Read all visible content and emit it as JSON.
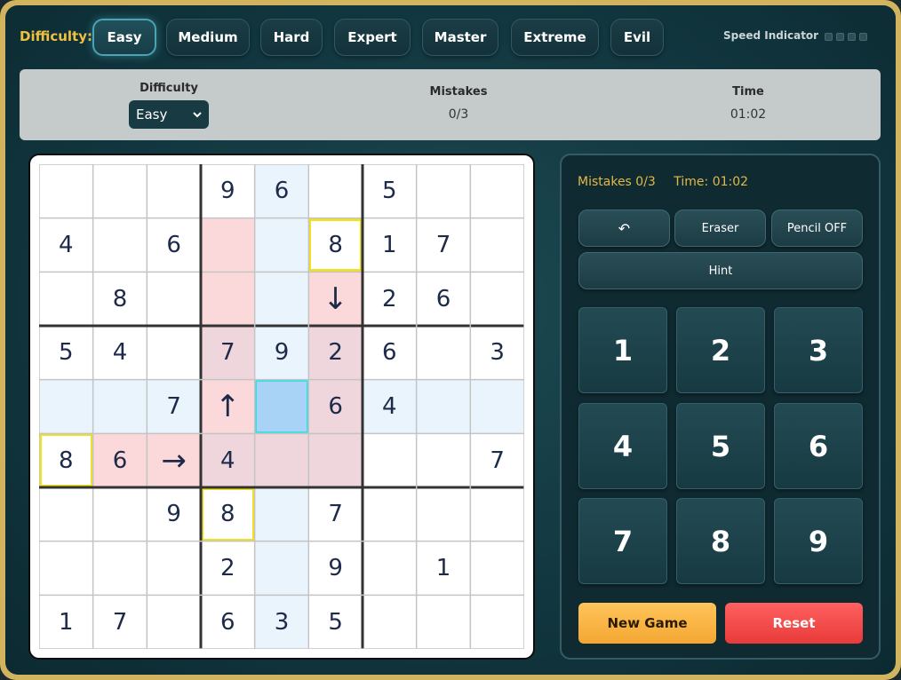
{
  "topbar": {
    "difficulty_label": "Difficulty:",
    "levels": [
      "Easy",
      "Medium",
      "Hard",
      "Expert",
      "Master",
      "Extreme",
      "Evil"
    ],
    "active_level": "Easy",
    "speed_label": "Speed Indicator"
  },
  "infobar": {
    "difficulty_head": "Difficulty",
    "difficulty_value": "Easy",
    "mistakes_head": "Mistakes",
    "mistakes_value": "0/3",
    "time_head": "Time",
    "time_value": "01:02"
  },
  "board": {
    "rows": [
      [
        "",
        "",
        "",
        "9",
        "6",
        "",
        "5",
        "",
        ""
      ],
      [
        "4",
        "",
        "6",
        "",
        "",
        "8",
        "1",
        "7",
        ""
      ],
      [
        "",
        "8",
        "",
        "",
        "",
        "↓",
        "2",
        "6",
        ""
      ],
      [
        "5",
        "4",
        "",
        "7",
        "9",
        "2",
        "6",
        "",
        "3"
      ],
      [
        "",
        "",
        "7",
        "↑",
        "",
        "6",
        "4",
        "",
        ""
      ],
      [
        "8",
        "6",
        "→",
        "4",
        "",
        "",
        "",
        "",
        "7"
      ],
      [
        "",
        "",
        "9",
        "8",
        "",
        "7",
        "",
        "",
        ""
      ],
      [
        "",
        "",
        "",
        "2",
        "",
        "9",
        "",
        "1",
        ""
      ],
      [
        "1",
        "7",
        "",
        "6",
        "3",
        "5",
        "",
        "",
        ""
      ]
    ],
    "selected_cell": [
      4,
      4
    ],
    "yellow_outlined_cells": [
      [
        1,
        5
      ],
      [
        5,
        0
      ],
      [
        6,
        3
      ]
    ],
    "colors": {
      "row_col_highlight": "#eaf4fc",
      "selected": "#a9d2f7",
      "selected_border": "#33e0e6",
      "conflict": "#fbd9da",
      "conflict_overlap": "#efd5dc",
      "yellow_border": "#f0e21e"
    }
  },
  "panel": {
    "mistakes_status": "Mistakes 0/3",
    "time_status": "Time: 01:02",
    "undo_icon": "undo-icon",
    "undo_glyph": "↶",
    "eraser_label": "Eraser",
    "pencil_label": "Pencil OFF",
    "hint_label": "Hint",
    "numbers": [
      "1",
      "2",
      "3",
      "4",
      "5",
      "6",
      "7",
      "8",
      "9"
    ],
    "new_game_label": "New Game",
    "reset_label": "Reset"
  }
}
